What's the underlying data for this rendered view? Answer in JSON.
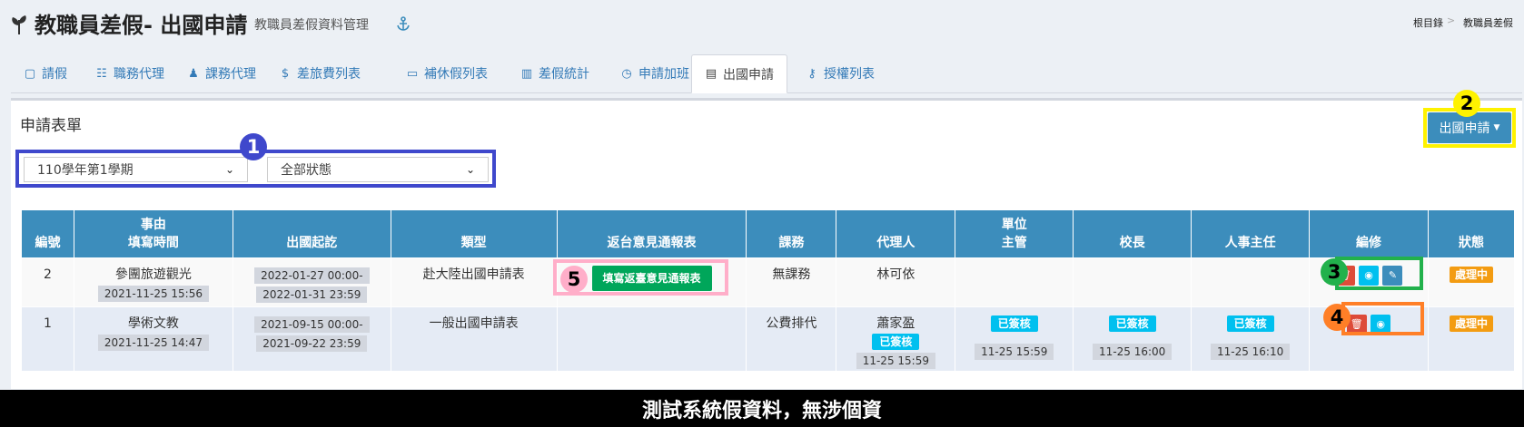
{
  "header": {
    "title": "教職員差假- 出國申請",
    "subtitle": "教職員差假資料管理",
    "breadcrumb": [
      "根目錄",
      "教職員差假"
    ]
  },
  "tabs": [
    {
      "label": "請假",
      "icon": "file-icon"
    },
    {
      "label": "職務代理",
      "icon": "group-icon"
    },
    {
      "label": "課務代理",
      "icon": "person-icon"
    },
    {
      "label": "差旅費列表",
      "icon": "dollar-icon"
    },
    {
      "label": "補休假列表",
      "icon": "toggle-icon"
    },
    {
      "label": "差假統計",
      "icon": "bar-chart-icon"
    },
    {
      "label": "申請加班",
      "icon": "clock-icon"
    },
    {
      "label": "出國申請",
      "icon": "document-icon",
      "active": true
    },
    {
      "label": "授權列表",
      "icon": "key-icon"
    }
  ],
  "panel": {
    "title": "申請表單",
    "dropdown_button": "出國申請"
  },
  "filters": {
    "semester": "110學年第1學期",
    "status": "全部狀態"
  },
  "callouts": {
    "n1": "1",
    "n2": "2",
    "n3": "3",
    "n4": "4",
    "n5": "5",
    "colors": {
      "blue": "#3f48cc",
      "yellow": "#fef200",
      "green": "#22b14c",
      "orange": "#ff7f27",
      "pink": "#ffaec9"
    }
  },
  "table": {
    "headers": {
      "no": "編號",
      "reason_l1": "事由",
      "reason_l2": "填寫時間",
      "period": "出國起訖",
      "type": "類型",
      "report": "返台意見通報表",
      "class": "課務",
      "agent": "代理人",
      "unit_l1": "單位",
      "unit_l2": "主管",
      "principal": "校長",
      "hr": "人事主任",
      "edit": "編修",
      "status": "狀態"
    },
    "rows": [
      {
        "no": "2",
        "reason": "參團旅遊觀光",
        "filled": "2021-11-25 15:56",
        "start": "2022-01-27 00:00-",
        "end": "2022-01-31 23:59",
        "type": "赴大陸出國申請表",
        "report_button": "填寫返臺意見通報表",
        "class": "無課務",
        "agent": "林可依",
        "status": "處理中"
      },
      {
        "no": "1",
        "reason": "學術文教",
        "filled": "2021-11-25 14:47",
        "start": "2021-09-15 00:00-",
        "end": "2021-09-22 23:59",
        "type": "一般出國申請表",
        "class": "公費排代",
        "agent": "蕭家盈",
        "agent_badge": "已簽核",
        "agent_time": "11-25 15:59",
        "unit_badge": "已簽核",
        "unit_time": "11-25 15:59",
        "principal_badge": "已簽核",
        "principal_time": "11-25 16:00",
        "hr_badge": "已簽核",
        "hr_time": "11-25 16:10",
        "status": "處理中"
      }
    ]
  },
  "footer": "測試系統假資料，無涉個資"
}
